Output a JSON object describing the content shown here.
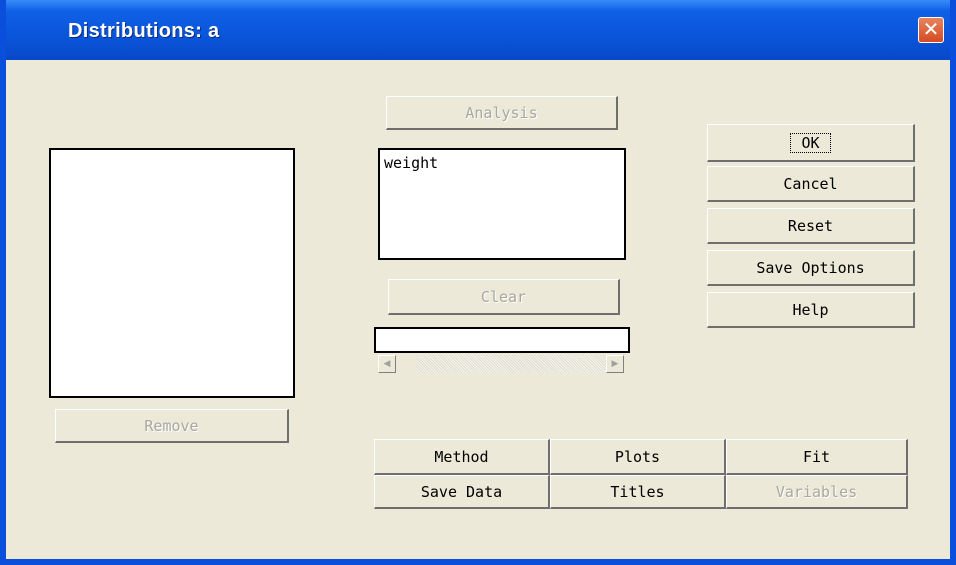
{
  "window": {
    "title": "Distributions: a"
  },
  "buttons": {
    "analysis": "Analysis",
    "ok": "OK",
    "cancel": "Cancel",
    "reset": "Reset",
    "save_options": "Save Options",
    "help": "Help",
    "clear": "Clear",
    "remove": "Remove"
  },
  "analysis_list": [
    "weight"
  ],
  "tabs": {
    "method": "Method",
    "plots": "Plots",
    "fit": "Fit",
    "save_data": "Save Data",
    "titles": "Titles",
    "variables": "Variables"
  },
  "colors": {
    "titlebar": "#0A55DA",
    "dialog_bg": "#ECE9D8",
    "close": "#D64A22"
  }
}
